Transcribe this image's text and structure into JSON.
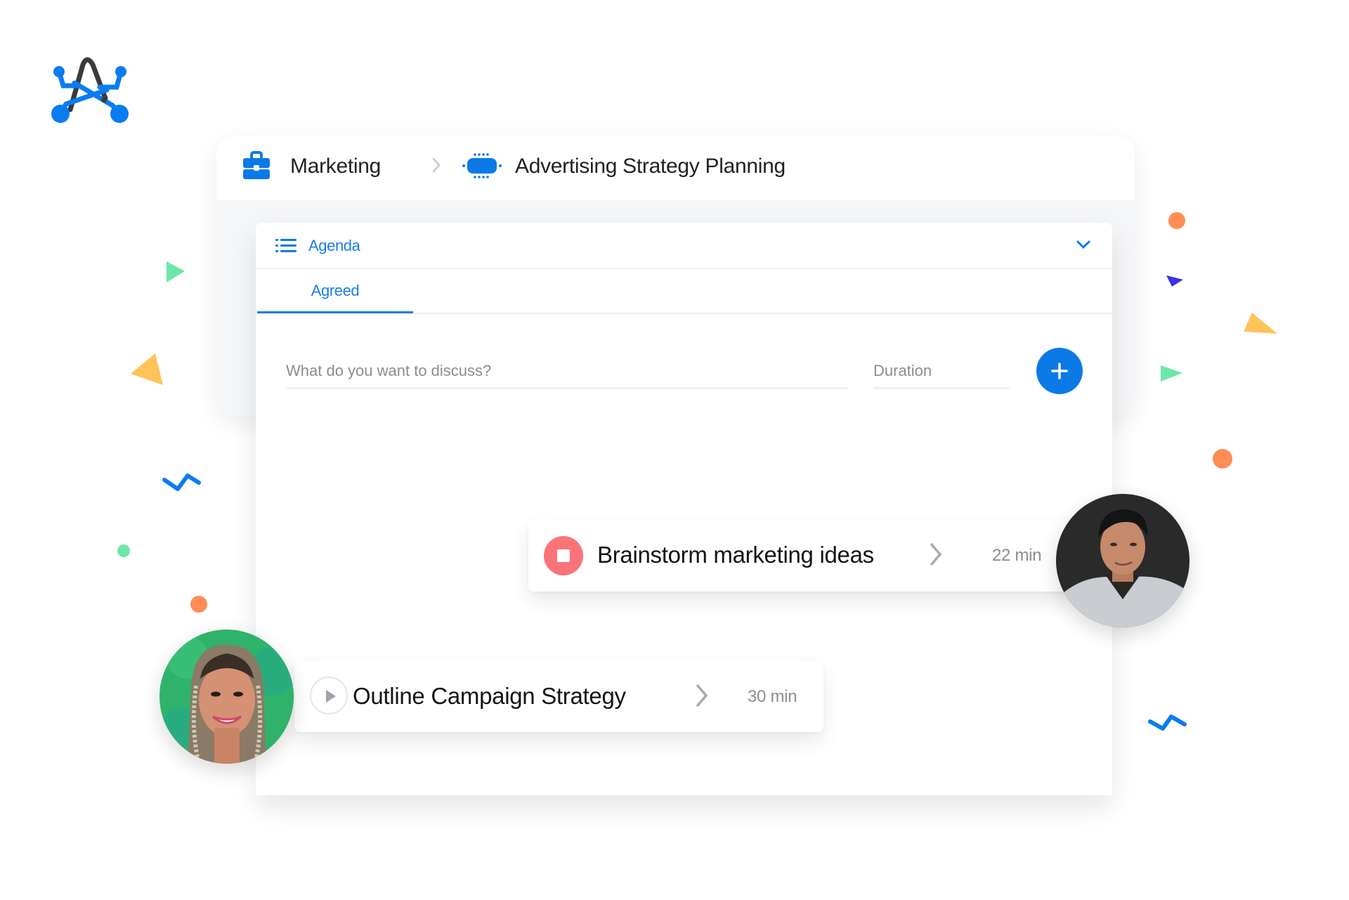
{
  "breadcrumb": {
    "team": {
      "label": "Marketing",
      "icon": "briefcase-icon"
    },
    "separator_icon": "chevron-right-icon",
    "meeting": {
      "label": "Advertising Strategy Planning",
      "icon": "chip-icon"
    }
  },
  "agenda": {
    "title": "Agenda",
    "icon": "list-icon",
    "toggle_icon": "chevron-down-icon",
    "tabs": [
      {
        "label": "Agreed",
        "active": true
      }
    ],
    "topic_input": {
      "placeholder": "What do you want to discuss?",
      "value": ""
    },
    "duration_input": {
      "placeholder": "Duration",
      "value": ""
    },
    "add_button_icon": "plus-icon"
  },
  "items": [
    {
      "title": "Brainstorm marketing ideas",
      "duration": "22 min",
      "status": "running",
      "control_icon": "stop-icon",
      "owner_avatar": "avatar-man"
    },
    {
      "title": "Outline Campaign Strategy",
      "duration": "30 min",
      "status": "paused",
      "control_icon": "play-icon",
      "owner_avatar": "avatar-woman"
    }
  ],
  "colors": {
    "accent": "#0b7ae6",
    "stop": "#f87478",
    "decor_green": "#6ee6a7",
    "decor_orange": "#ff8c55",
    "decor_yellow": "#ffc35a",
    "decor_indigo": "#3b32e0",
    "decor_blue": "#0a7cf2"
  }
}
